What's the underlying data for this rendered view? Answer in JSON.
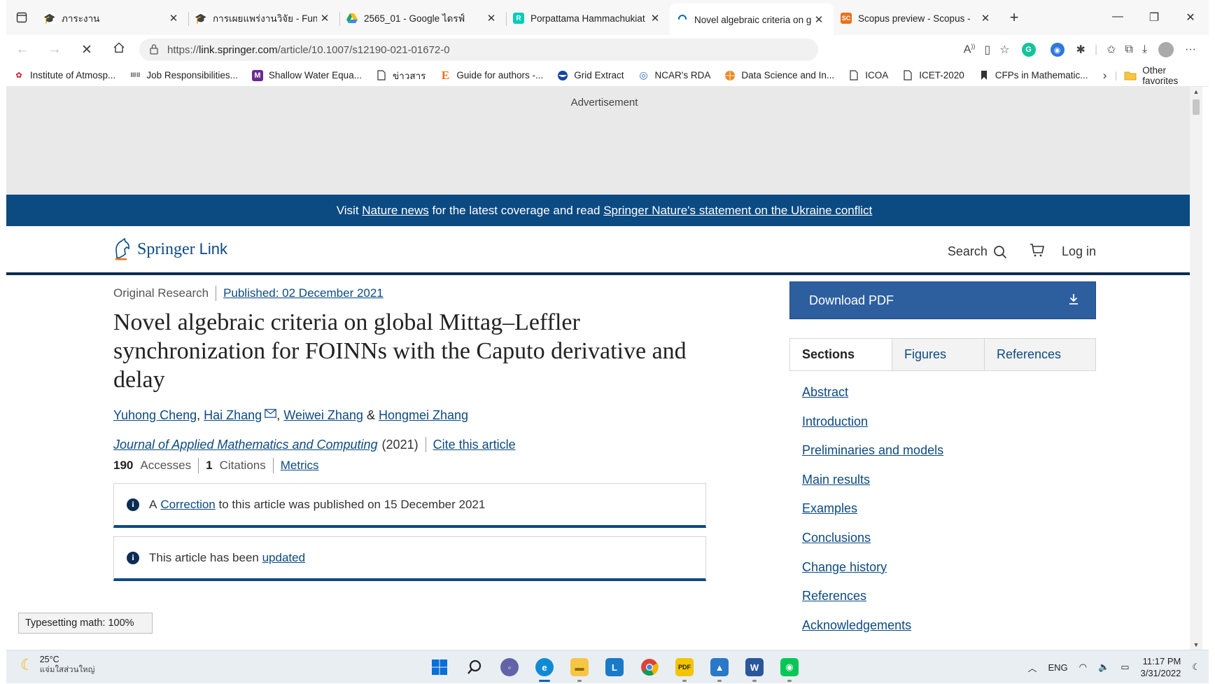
{
  "browser": {
    "tabs": [
      {
        "title": "ภาระงาน",
        "favicon": "hat-icon",
        "color": "#c8102e"
      },
      {
        "title": "การเผยแพร่งานวิจัย - Fund",
        "favicon": "hat-icon",
        "color": "#c8102e"
      },
      {
        "title": "2565_01 - Google ไดรฟ์",
        "favicon": "google-drive-icon",
        "color": "#1ea362"
      },
      {
        "title": "Porpattama Hammachukiat",
        "favicon": "researchgate-icon",
        "color": "#00ccbb"
      },
      {
        "title": "Novel algebraic criteria on g",
        "favicon": "loading-icon",
        "color": "#0067c0",
        "active": true
      },
      {
        "title": "Scopus preview - Scopus - ",
        "favicon": "scopus-icon",
        "color": "#e9711c"
      }
    ],
    "url_prefix": "https://",
    "url_host": "link.springer.com",
    "url_path": "/article/10.1007/s12190-021-01672-0",
    "favorites": [
      {
        "label": "Institute of Atmosp...",
        "icon": "huawei-icon",
        "color": "#cf0a2c"
      },
      {
        "label": "Job Responsibilities...",
        "icon": "site-icon",
        "color": "#777777"
      },
      {
        "label": "Shallow Water Equa...",
        "icon": "m-icon",
        "color": "#6a2a8e"
      },
      {
        "label": "ข่าวสาร",
        "icon": "page-icon",
        "color": "#333333"
      },
      {
        "label": "Guide for authors -...",
        "icon": "elsevier-icon",
        "color": "#e9711c"
      },
      {
        "label": "Grid Extract",
        "icon": "noaa-icon",
        "color": "#1546a0"
      },
      {
        "label": "NCAR's RDA",
        "icon": "ncar-icon",
        "color": "#2a6ab8"
      },
      {
        "label": "Data Science and In...",
        "icon": "globe-icon",
        "color": "#e98b28"
      },
      {
        "label": "ICOA",
        "icon": "page-icon",
        "color": "#333333"
      },
      {
        "label": "ICET-2020",
        "icon": "page-icon",
        "color": "#333333"
      },
      {
        "label": "CFPs in Mathematic...",
        "icon": "bookmark-icon",
        "color": "#333333"
      }
    ],
    "other_favorites": "Other favorites"
  },
  "page": {
    "ad_label": "Advertisement",
    "banner": {
      "pre": "Visit ",
      "link1": "Nature news",
      "mid": " for the latest coverage and read ",
      "link2": "Springer Nature's statement on the Ukraine conflict"
    },
    "header": {
      "logo_springer": "Springer",
      "logo_link": "Link",
      "search_label": "Search",
      "login_label": "Log in"
    },
    "article": {
      "type": "Original Research",
      "published": "Published: 02 December 2021",
      "title": "Novel algebraic criteria on global Mittag–Leffler synchronization for FOINNs with the Caputo derivative and delay",
      "authors": [
        "Yuhong Cheng",
        "Hai Zhang",
        "Weiwei Zhang",
        "Hongmei Zhang"
      ],
      "author_sep1": ", ",
      "author_sep2": ", ",
      "author_amp": " & ",
      "journal": "Journal of Applied Mathematics and Computing",
      "year": "(2021)",
      "cite": "Cite this article",
      "accesses_count": "190",
      "accesses_label": "Accesses",
      "citations_count": "1",
      "citations_label": "Citations",
      "metrics_label": "Metrics",
      "notice1_pre": "A ",
      "notice1_link": "Correction",
      "notice1_post": " to this article was published on 15 December 2021",
      "notice2_pre": "This article has been ",
      "notice2_link": "updated"
    },
    "sidebar": {
      "download_label": "Download PDF",
      "tabs": [
        "Sections",
        "Figures",
        "References"
      ],
      "sections": [
        "Abstract",
        "Introduction",
        "Preliminaries and models",
        "Main results",
        "Examples",
        "Conclusions",
        "Change history",
        "References",
        "Acknowledgements"
      ]
    },
    "status_popup": "Typesetting math: 100%"
  },
  "taskbar": {
    "temperature": "25°C",
    "weather": "แจ่มใสส่วนใหญ่",
    "language": "ENG",
    "time": "11:17 PM",
    "date": "3/31/2022"
  }
}
